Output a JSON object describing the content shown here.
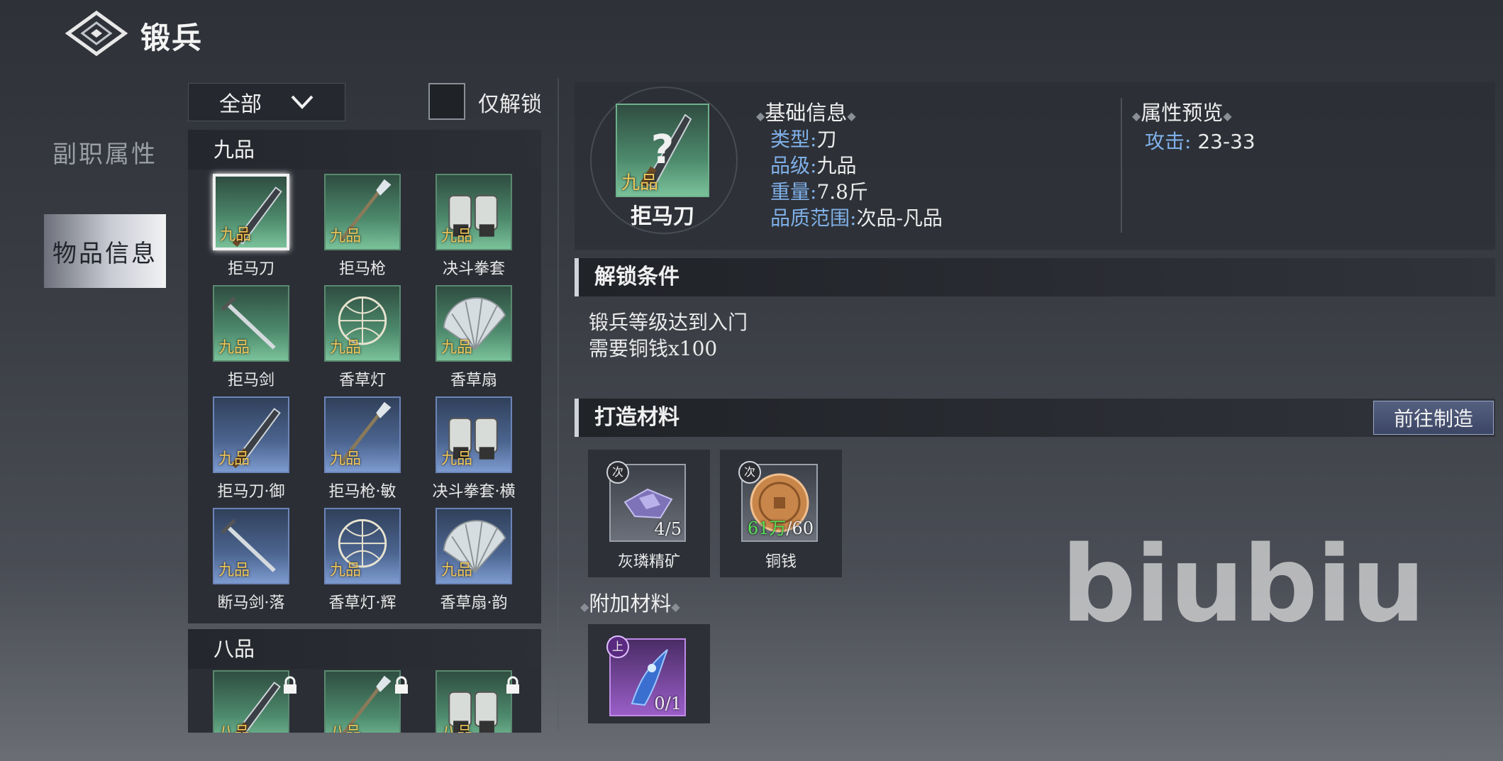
{
  "header": {
    "title": "锻兵",
    "back_icon": "diamond-back-icon"
  },
  "side_tabs": [
    {
      "label": "副职属性",
      "active": false
    },
    {
      "label": "物品信息",
      "active": true
    }
  ],
  "filter": {
    "selected": "全部",
    "only_unlocked_label": "仅解锁",
    "only_unlocked_checked": false
  },
  "item_list": {
    "groups": [
      {
        "grade": "九品",
        "items": [
          {
            "name": "拒马刀",
            "quality": "九品",
            "tier": "green",
            "icon": "saber-icon",
            "selected": true
          },
          {
            "name": "拒马枪",
            "quality": "九品",
            "tier": "green",
            "icon": "spear-icon"
          },
          {
            "name": "决斗拳套",
            "quality": "九品",
            "tier": "green",
            "icon": "gauntlet-icon"
          },
          {
            "name": "拒马剑",
            "quality": "九品",
            "tier": "green",
            "icon": "sword-icon"
          },
          {
            "name": "香草灯",
            "quality": "九品",
            "tier": "green",
            "icon": "lantern-icon"
          },
          {
            "name": "香草扇",
            "quality": "九品",
            "tier": "green",
            "icon": "fan-icon"
          },
          {
            "name": "拒马刀·御",
            "quality": "九品",
            "tier": "blue",
            "icon": "saber-icon"
          },
          {
            "name": "拒马枪·敏",
            "quality": "九品",
            "tier": "blue",
            "icon": "spear-icon"
          },
          {
            "name": "决斗拳套·横",
            "quality": "九品",
            "tier": "blue",
            "icon": "gauntlet-icon"
          },
          {
            "name": "断马剑·落",
            "quality": "九品",
            "tier": "blue",
            "icon": "sword-icon"
          },
          {
            "name": "香草灯·辉",
            "quality": "九品",
            "tier": "blue",
            "icon": "lantern-icon"
          },
          {
            "name": "香草扇·韵",
            "quality": "九品",
            "tier": "blue",
            "icon": "fan-icon"
          }
        ]
      },
      {
        "grade": "八品",
        "items": [
          {
            "name": "",
            "quality": "八品",
            "tier": "green",
            "icon": "saber-icon",
            "locked": true
          },
          {
            "name": "",
            "quality": "八品",
            "tier": "green",
            "icon": "spear-icon",
            "locked": true
          },
          {
            "name": "",
            "quality": "八品",
            "tier": "green",
            "icon": "gauntlet-icon",
            "locked": true
          }
        ]
      }
    ]
  },
  "detail": {
    "name": "拒马刀",
    "quality_tag": "九品",
    "basic_info_title": "基础信息",
    "basic_info": [
      {
        "key": "类型",
        "value": "刀"
      },
      {
        "key": "品级",
        "value": "九品"
      },
      {
        "key": "重量",
        "value": "7.8斤"
      },
      {
        "key": "品质范围",
        "value": "次品-凡品"
      }
    ],
    "attr_title": "属性预览",
    "attrs": [
      {
        "key": "攻击:",
        "value": "23-33"
      }
    ]
  },
  "unlock": {
    "title": "解锁条件",
    "conditions": [
      "锻兵等级达到入门",
      "需要铜钱x100"
    ]
  },
  "materials": {
    "title": "打造材料",
    "goto_label": "前往制造",
    "items": [
      {
        "name": "灰璘精矿",
        "badge": "次",
        "have": "4",
        "need": "5",
        "icon": "ore-crystal-icon"
      },
      {
        "name": "铜钱",
        "badge": "次",
        "have": "61万",
        "need": "60",
        "icon": "copper-coin-icon"
      }
    ],
    "extra_title": "附加材料",
    "extra": [
      {
        "badge": "上",
        "have": "0",
        "need": "1",
        "icon": "blue-spirit-icon"
      }
    ]
  },
  "watermark": "biubiu",
  "colors": {
    "key_blue": "#7fb0e8",
    "quality_gold": "#f0c65a",
    "have_green": "#55e055",
    "green_tier": "#4d8a6c",
    "blue_tier": "#4c6590",
    "purple_tier": "#9a5ec8"
  }
}
